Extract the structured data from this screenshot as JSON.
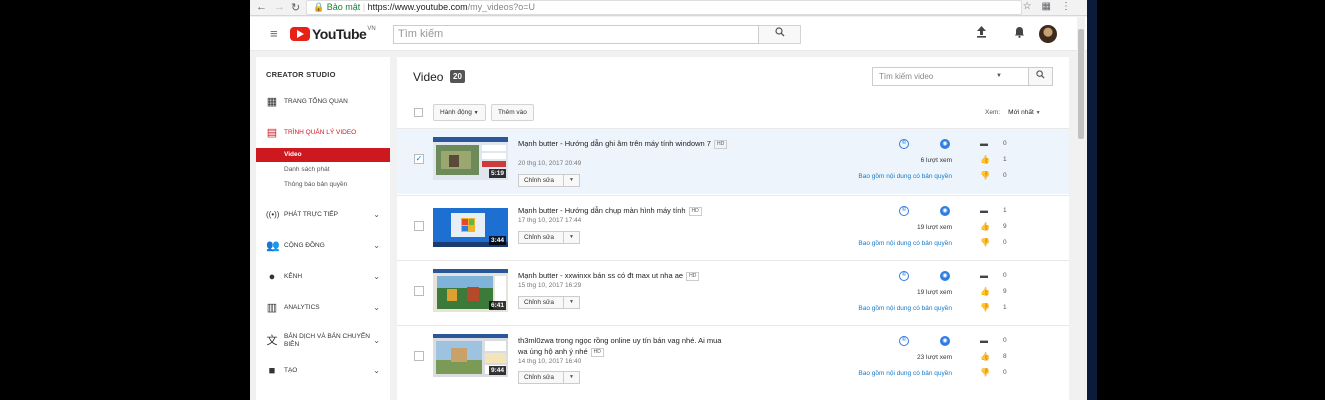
{
  "browser": {
    "back": "←",
    "forward": "→",
    "reload": "↻",
    "secure_label": "Bảo mật",
    "url_host": "https://www.youtube.com",
    "url_path": "/my_videos?o=U"
  },
  "masthead": {
    "logo_text": "YouTube",
    "region": "VN",
    "search_placeholder": "Tìm kiếm"
  },
  "sidebar": {
    "title": "CREATOR STUDIO",
    "items": [
      {
        "label": "TRANG TỔNG QUAN"
      },
      {
        "label": "TRÌNH QUẢN LÝ VIDEO"
      },
      {
        "label": "PHÁT TRỰC TIẾP"
      },
      {
        "label": "CỘNG ĐỒNG"
      },
      {
        "label": "KÊNH"
      },
      {
        "label": "ANALYTICS"
      },
      {
        "label": "BẢN DỊCH VÀ BẢN CHUYỂN BIÊN"
      },
      {
        "label": "TẠO"
      }
    ],
    "sub_items": [
      "Video",
      "Danh sách phát",
      "Thông báo bản quyền"
    ]
  },
  "main": {
    "title": "Video",
    "count": "20",
    "search_placeholder": "Tìm kiếm video",
    "action_button": "Hành động",
    "add_button": "Thêm vào",
    "sort_label": "Xem:",
    "sort_value": "Mới nhất",
    "edit_label": "Chỉnh sửa",
    "hd_label": "HD",
    "copyright_text": "Bao gồm nội dung có bản quyền"
  },
  "videos": [
    {
      "title": "Mạnh butter - Hướng dẫn ghi âm trên máy tính windown 7",
      "date": "20 thg 10, 2017 20:49",
      "duration": "5:19",
      "views": "6 lượt xem",
      "comments": "0",
      "likes": "1",
      "dislikes": "0",
      "selected": true
    },
    {
      "title": "Mạnh butter - Hướng dẫn chụp màn hình máy tính",
      "date": "17 thg 10, 2017 17:44",
      "duration": "3:44",
      "views": "19 lượt xem",
      "comments": "1",
      "likes": "9",
      "dislikes": "0",
      "selected": false
    },
    {
      "title": "Mạnh butter - xxwinxx bán ss có đt max ut nha ae",
      "date": "15 thg 10, 2017 16:29",
      "duration": "6:41",
      "views": "19 lượt xem",
      "comments": "0",
      "likes": "9",
      "dislikes": "1",
      "selected": false
    },
    {
      "title": "th3ml0zwa trong ngọc rồng online uy tín bán vag nhé. Ai mua wa ủng hộ anh ý nhé",
      "date": "14 thg 10, 2017 16:40",
      "duration": "9:44",
      "views": "23 lượt xem",
      "comments": "0",
      "likes": "8",
      "dislikes": "0",
      "selected": false
    }
  ]
}
